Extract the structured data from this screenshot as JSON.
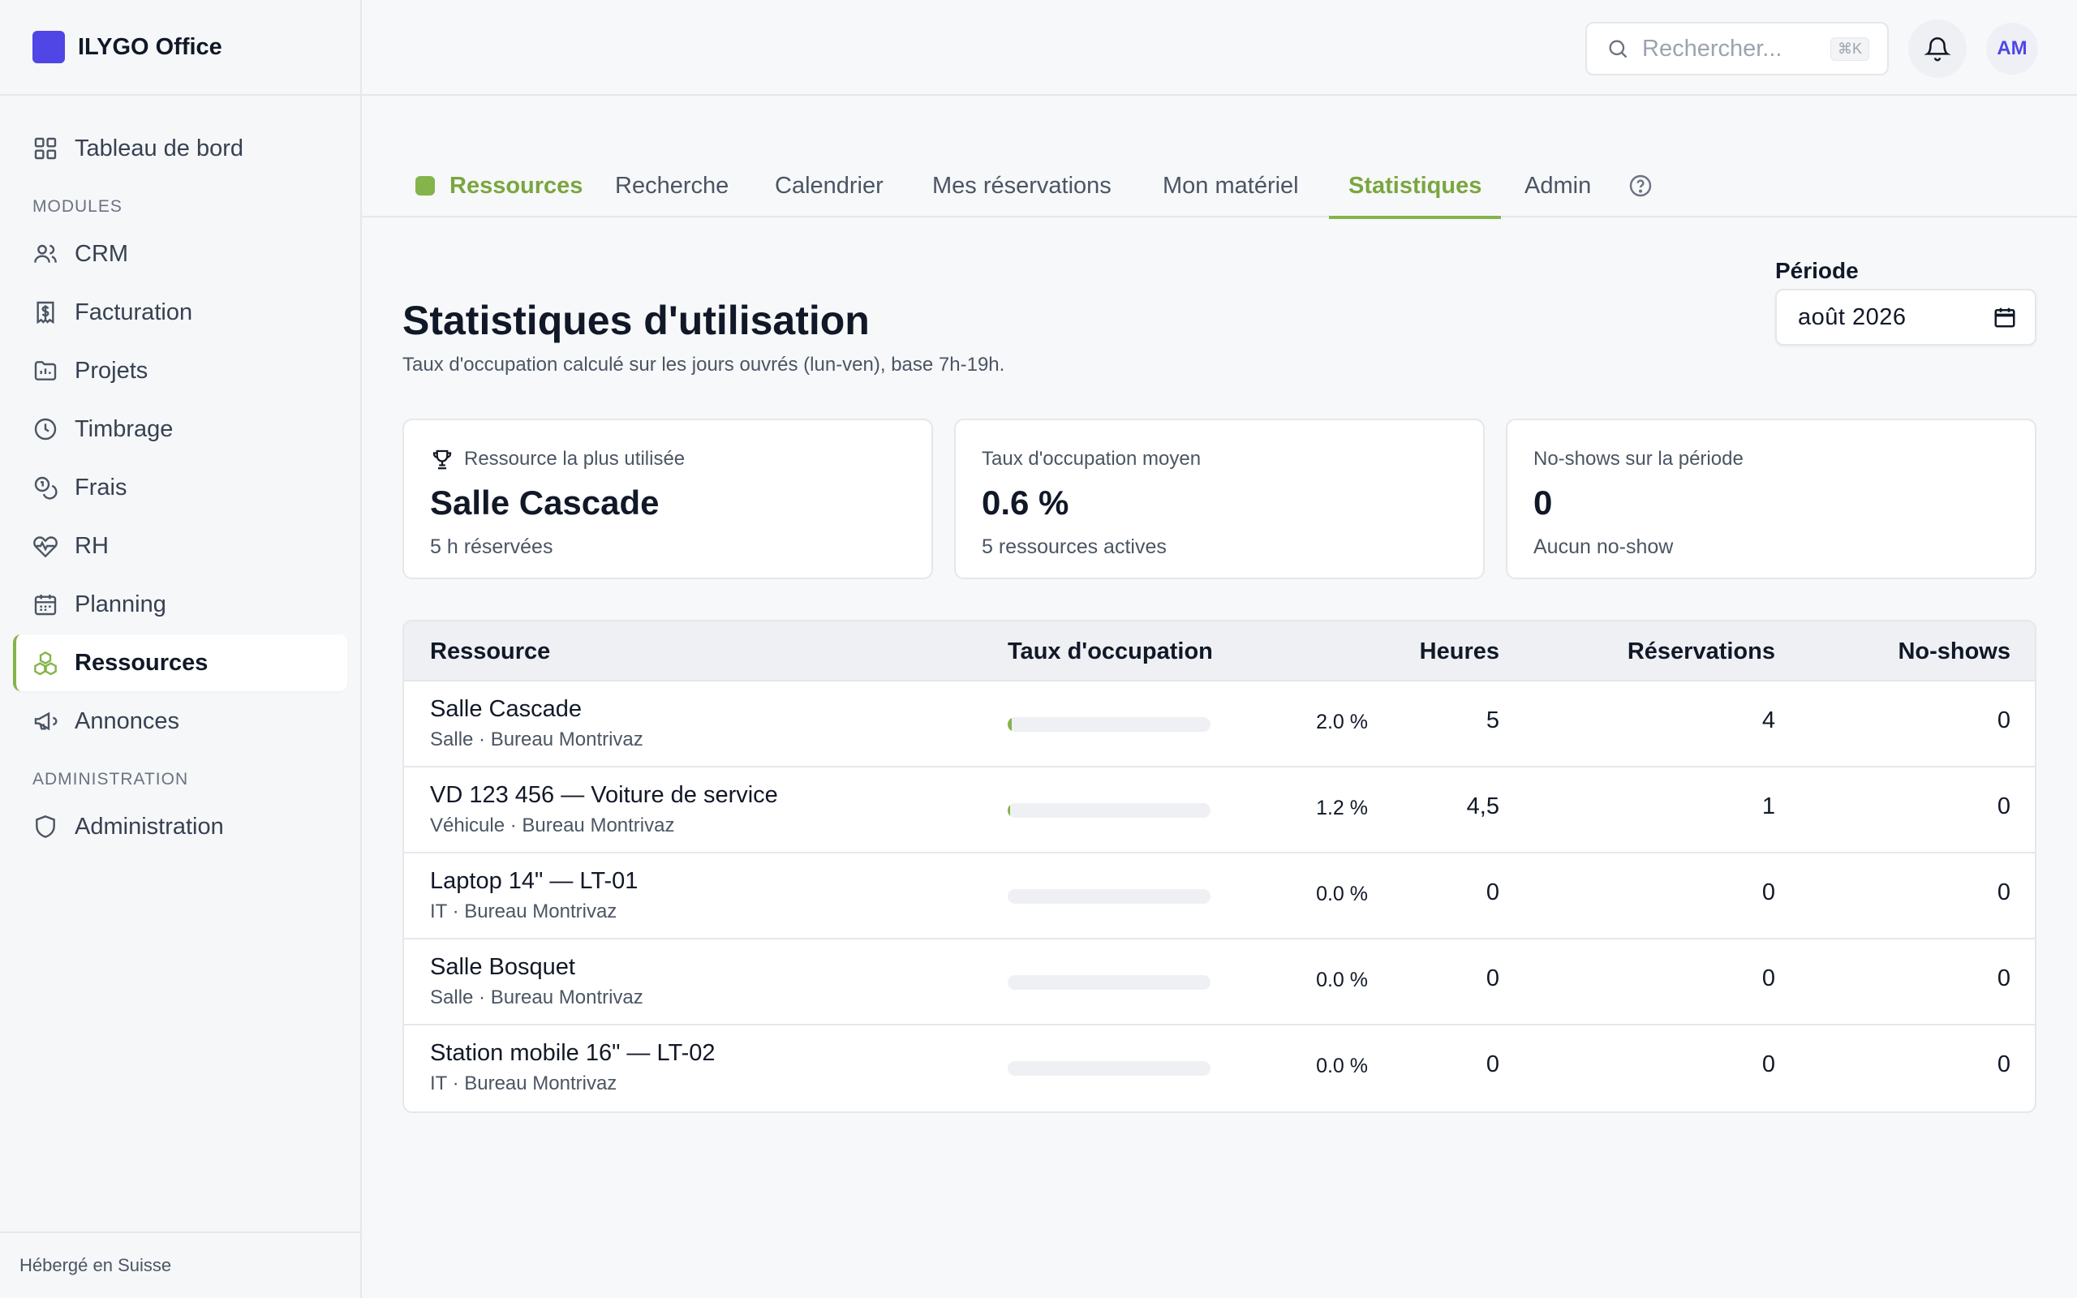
{
  "app": {
    "name": "ILYGO Office"
  },
  "sidebar": {
    "top_item": {
      "label": "Tableau de bord",
      "icon": "dashboard-icon"
    },
    "modules_label": "MODULES",
    "modules": [
      {
        "label": "CRM",
        "icon": "users-icon"
      },
      {
        "label": "Facturation",
        "icon": "invoice-icon"
      },
      {
        "label": "Projets",
        "icon": "folder-icon"
      },
      {
        "label": "Timbrage",
        "icon": "clock-icon"
      },
      {
        "label": "Frais",
        "icon": "coins-icon"
      },
      {
        "label": "RH",
        "icon": "heart-pulse-icon"
      },
      {
        "label": "Planning",
        "icon": "calendar-icon"
      },
      {
        "label": "Ressources",
        "icon": "boxes-icon",
        "active": true
      },
      {
        "label": "Annonces",
        "icon": "megaphone-icon"
      }
    ],
    "admin_label": "ADMINISTRATION",
    "admin_item": {
      "label": "Administration",
      "icon": "shield-icon"
    },
    "footer": "Hébergé en Suisse"
  },
  "header": {
    "search_placeholder": "Rechercher...",
    "search_shortcut": "⌘K",
    "avatar_initials": "AM"
  },
  "tabs": {
    "brand": "Ressources",
    "items": [
      "Recherche",
      "Calendrier",
      "Mes réservations",
      "Mon matériel",
      "Statistiques",
      "Admin"
    ],
    "active": "Statistiques"
  },
  "page": {
    "title": "Statistiques d'utilisation",
    "subtitle": "Taux d'occupation calculé sur les jours ouvrés (lun-ven), base 7h-19h.",
    "period_label": "Période",
    "period_value": "août 2026"
  },
  "cards": [
    {
      "label": "Ressource la plus utilisée",
      "value": "Salle Cascade",
      "note": "5 h réservées",
      "icon": "trophy-icon"
    },
    {
      "label": "Taux d'occupation moyen",
      "value": "0.6 %",
      "note": "5 ressources actives"
    },
    {
      "label": "No-shows sur la période",
      "value": "0",
      "note": "Aucun no-show"
    }
  ],
  "table": {
    "headers": {
      "resource": "Ressource",
      "occupancy": "Taux d'occupation",
      "hours": "Heures",
      "bookings": "Réservations",
      "noshows": "No-shows"
    },
    "rows": [
      {
        "name": "Salle Cascade",
        "meta": "Salle · Bureau Montrivaz",
        "occupancy": 2.0,
        "occupancy_label": "2.0 %",
        "hours": "5",
        "bookings": "4",
        "noshows": "0"
      },
      {
        "name": "VD 123 456 — Voiture de service",
        "meta": "Véhicule · Bureau Montrivaz",
        "occupancy": 1.2,
        "occupancy_label": "1.2 %",
        "hours": "4,5",
        "bookings": "1",
        "noshows": "0"
      },
      {
        "name": "Laptop 14\" — LT-01",
        "meta": "IT · Bureau Montrivaz",
        "occupancy": 0.0,
        "occupancy_label": "0.0 %",
        "hours": "0",
        "bookings": "0",
        "noshows": "0"
      },
      {
        "name": "Salle Bosquet",
        "meta": "Salle · Bureau Montrivaz",
        "occupancy": 0.0,
        "occupancy_label": "0.0 %",
        "hours": "0",
        "bookings": "0",
        "noshows": "0"
      },
      {
        "name": "Station mobile 16\" — LT-02",
        "meta": "IT · Bureau Montrivaz",
        "occupancy": 0.0,
        "occupancy_label": "0.0 %",
        "hours": "0",
        "bookings": "0",
        "noshows": "0"
      }
    ]
  },
  "colors": {
    "accent": "#84b44a",
    "brand": "#4f46e5"
  }
}
